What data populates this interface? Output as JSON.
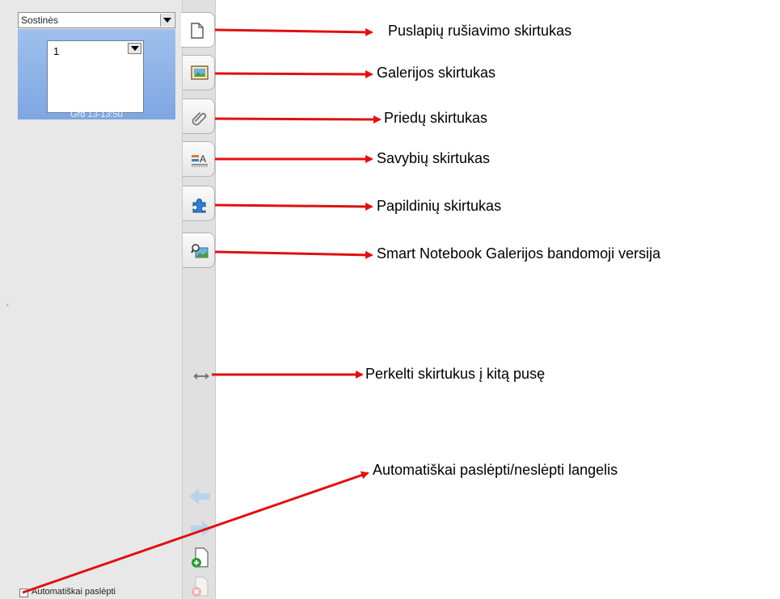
{
  "sidebar": {
    "sort_dropdown": "Sostinės",
    "page": {
      "number": "1",
      "timestamp": "Grd 13-13:50"
    },
    "autohide_label": "Automatiškai paslėpti"
  },
  "tabs": [
    {
      "icon": "page-sorter-icon"
    },
    {
      "icon": "gallery-icon"
    },
    {
      "icon": "attachments-icon"
    },
    {
      "icon": "properties-icon"
    },
    {
      "icon": "addons-icon"
    },
    {
      "icon": "gallery-trial-icon"
    }
  ],
  "annotations": {
    "page_sorter": "Puslapių rušiavimo skirtukas",
    "gallery": "Galerijos skirtukas",
    "attachments": "Priedų skirtukas",
    "properties": "Savybių skirtukas",
    "addons": "Papildinių skirtukas",
    "gallery_trial": "Smart Notebook Galerijos bandomoji versija",
    "move_tabs": "Perkelti skirtukus į kitą pusę",
    "autohide": "Automatiškai paslėpti/neslėpti langelis"
  },
  "colors": {
    "arrow": "#e01010",
    "thumbnail_bg": "#8fb2e8"
  }
}
